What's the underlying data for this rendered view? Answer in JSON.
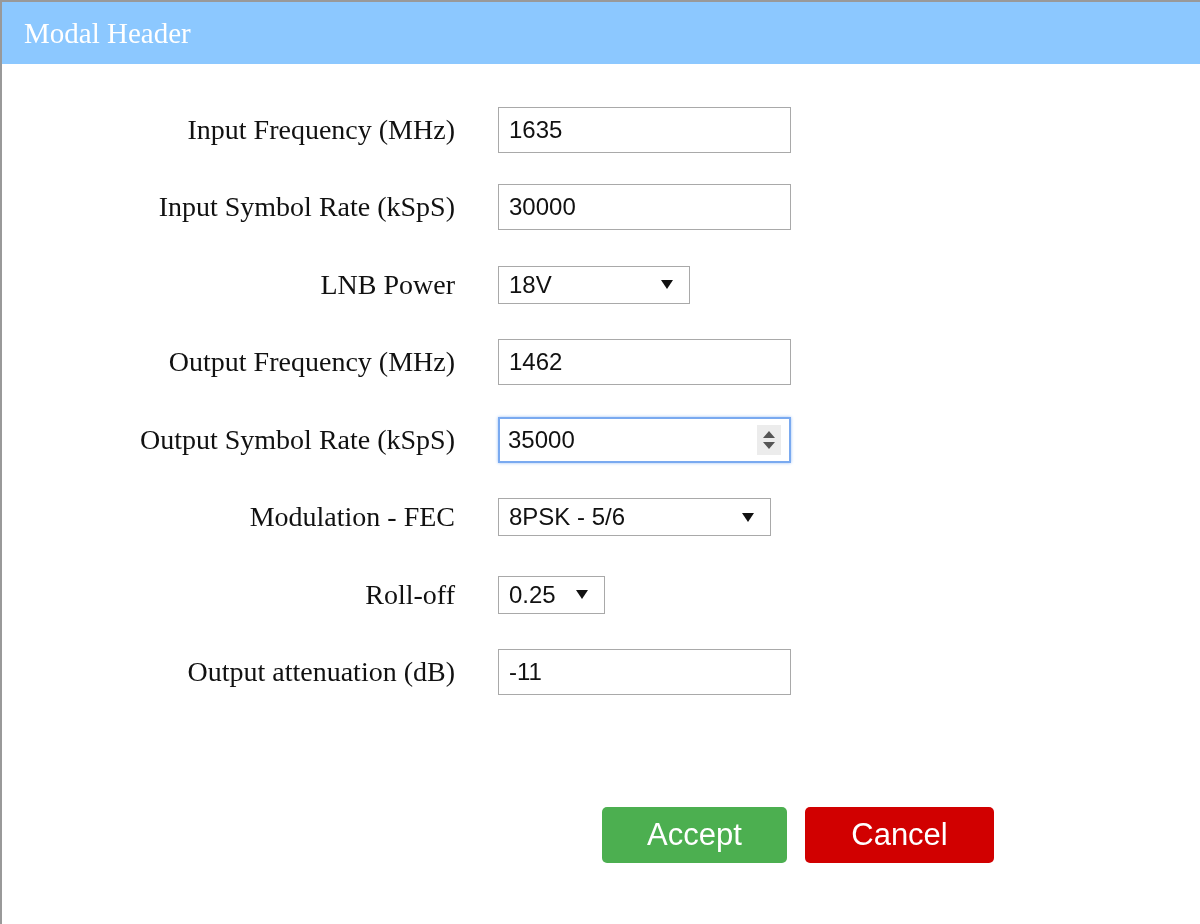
{
  "modal": {
    "title": "Modal Header"
  },
  "fields": [
    {
      "label": "Input Frequency (MHz)",
      "kind": "text",
      "value": "1635",
      "focused": false
    },
    {
      "label": "Input Symbol Rate (kSpS)",
      "kind": "text",
      "value": "30000",
      "focused": false
    },
    {
      "label": "LNB Power",
      "kind": "select",
      "value": "18V",
      "focused": false
    },
    {
      "label": "Output Frequency (MHz)",
      "kind": "text",
      "value": "1462",
      "focused": false
    },
    {
      "label": "Output Symbol Rate (kSpS)",
      "kind": "number",
      "value": "35000",
      "focused": true
    },
    {
      "label": "Modulation - FEC",
      "kind": "select",
      "value": "8PSK - 5/6",
      "focused": false
    },
    {
      "label": "Roll-off",
      "kind": "select",
      "value": "0.25",
      "focused": false
    },
    {
      "label": "Output attenuation (dB)",
      "kind": "text",
      "value": "-11",
      "focused": false
    }
  ],
  "buttons": [
    {
      "label": "Accept",
      "kind": "accept"
    },
    {
      "label": "Cancel",
      "kind": "cancel"
    }
  ]
}
